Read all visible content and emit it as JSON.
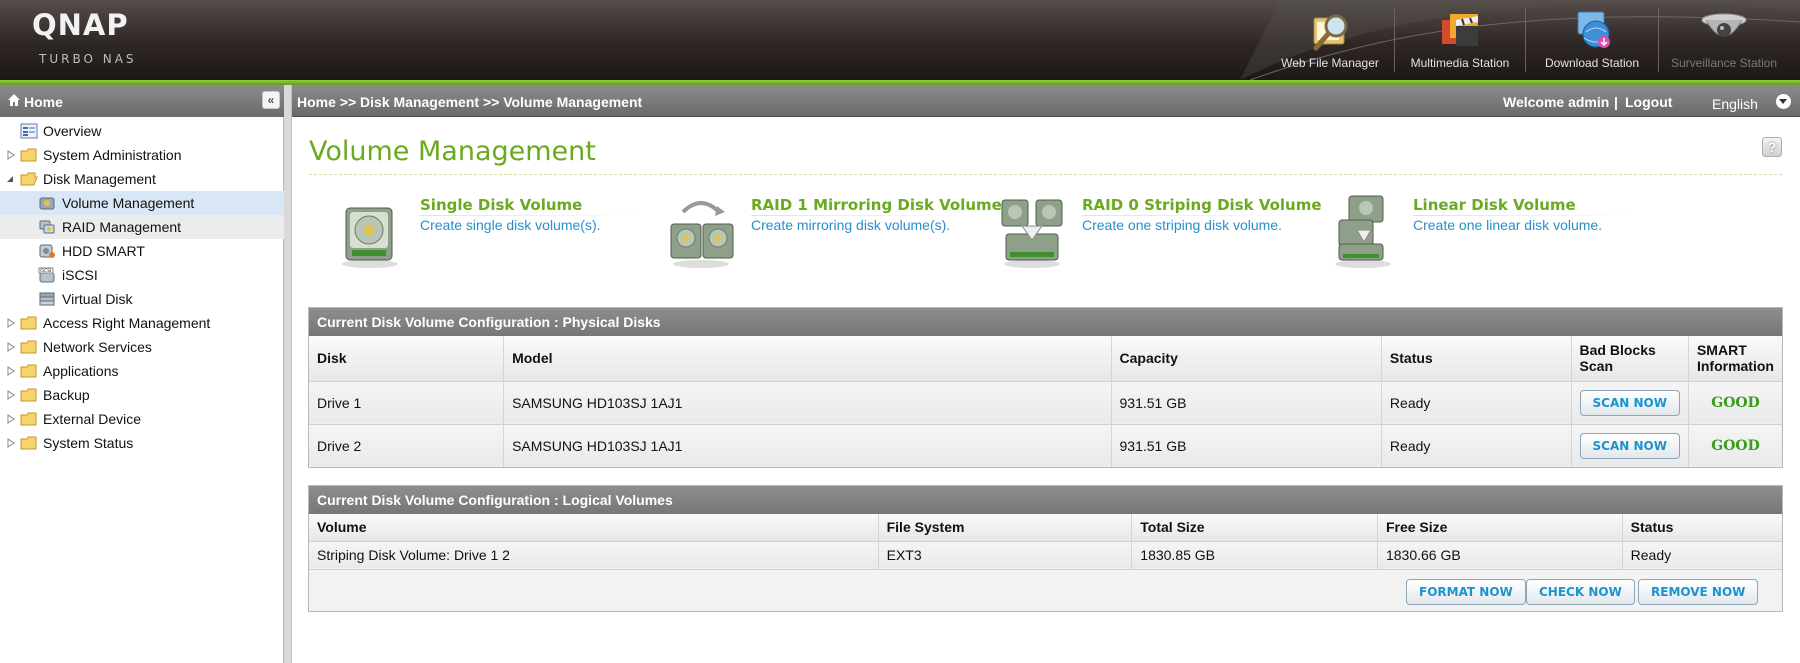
{
  "brand": {
    "logo": "QNAP",
    "product": "TURBO NAS"
  },
  "header_apps": [
    {
      "label": "Web File Manager",
      "icon": "magnifier-folder-icon"
    },
    {
      "label": "Multimedia Station",
      "icon": "clapperboard-icon"
    },
    {
      "label": "Download Station",
      "icon": "download-globe-icon"
    },
    {
      "label": "Surveillance Station",
      "icon": "security-camera-icon"
    }
  ],
  "sidebar": {
    "title": "Home",
    "collapse_glyph": "«",
    "items": [
      {
        "label": "Overview",
        "icon": "overview-icon",
        "level": 0
      },
      {
        "label": "System Administration",
        "icon": "folder-icon",
        "level": 0
      },
      {
        "label": "Disk Management",
        "icon": "folder-open-icon",
        "level": 0,
        "expanded": true
      },
      {
        "label": "Volume Management",
        "icon": "volume-disk-icon",
        "level": 1,
        "selected": true
      },
      {
        "label": "RAID Management",
        "icon": "raid-icon",
        "level": 1
      },
      {
        "label": "HDD SMART",
        "icon": "hdd-smart-icon",
        "level": 1
      },
      {
        "label": "iSCSI",
        "icon": "iscsi-icon",
        "level": 1
      },
      {
        "label": "Virtual Disk",
        "icon": "virtual-disk-icon",
        "level": 1
      },
      {
        "label": "Access Right Management",
        "icon": "folder-icon",
        "level": 0
      },
      {
        "label": "Network Services",
        "icon": "folder-icon",
        "level": 0
      },
      {
        "label": "Applications",
        "icon": "folder-icon",
        "level": 0
      },
      {
        "label": "Backup",
        "icon": "folder-icon",
        "level": 0
      },
      {
        "label": "External Device",
        "icon": "folder-icon",
        "level": 0
      },
      {
        "label": "System Status",
        "icon": "folder-icon",
        "level": 0
      }
    ]
  },
  "topbar": {
    "breadcrumb": "Home >> Disk Management >> Volume Management",
    "welcome": "Welcome admin",
    "separator": "|",
    "logout": "Logout",
    "language": "English"
  },
  "page": {
    "title": "Volume Management",
    "help_glyph": "?"
  },
  "volume_types": [
    {
      "name": "Single Disk Volume",
      "desc": "Create single disk volume(s).",
      "icon": "single-disk-icon"
    },
    {
      "name": "RAID 1 Mirroring Disk Volume",
      "desc": "Create mirroring disk volume(s).",
      "icon": "mirroring-disk-icon"
    },
    {
      "name": "RAID 0 Striping Disk Volume",
      "desc": "Create one striping disk volume.",
      "icon": "striping-disk-icon"
    },
    {
      "name": "Linear Disk Volume",
      "desc": "Create one linear disk volume.",
      "icon": "linear-disk-icon"
    }
  ],
  "physical": {
    "heading": "Current Disk Volume Configuration : Physical Disks",
    "columns": [
      "Disk",
      "Model",
      "Capacity",
      "Status",
      "Bad Blocks\nScan",
      "SMART\nInformation"
    ],
    "rows": [
      {
        "disk": "Drive 1",
        "model": "SAMSUNG HD103SJ 1AJ1",
        "capacity": "931.51 GB",
        "status": "Ready",
        "scan": "SCAN NOW",
        "smart": "GOOD"
      },
      {
        "disk": "Drive 2",
        "model": "SAMSUNG HD103SJ 1AJ1",
        "capacity": "931.51 GB",
        "status": "Ready",
        "scan": "SCAN NOW",
        "smart": "GOOD"
      }
    ]
  },
  "logical": {
    "heading": "Current Disk Volume Configuration : Logical Volumes",
    "columns": [
      "Volume",
      "File System",
      "Total Size",
      "Free Size",
      "Status"
    ],
    "rows": [
      {
        "volume": "Striping Disk Volume: Drive 1 2",
        "fs": "EXT3",
        "total": "1830.85 GB",
        "free": "1830.66 GB",
        "status": "Ready"
      }
    ],
    "actions": [
      "FORMAT NOW",
      "CHECK NOW",
      "REMOVE NOW"
    ]
  },
  "colors": {
    "accent_green": "#6aaa1e",
    "link_blue": "#2a8fc8",
    "good_green": "#3a9a1a"
  }
}
